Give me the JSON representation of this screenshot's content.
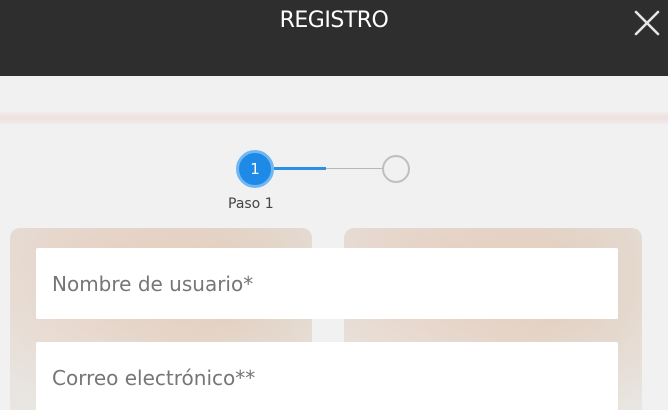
{
  "header": {
    "title": "REGISTRO",
    "close_icon": "close-icon"
  },
  "stepper": {
    "current_step": "1",
    "current_label": "Paso 1",
    "total_steps": 2,
    "active_color": "#1e8ae8"
  },
  "form": {
    "username_placeholder": "Nombre de usuario*",
    "email_placeholder": "Correo electrónico**"
  }
}
